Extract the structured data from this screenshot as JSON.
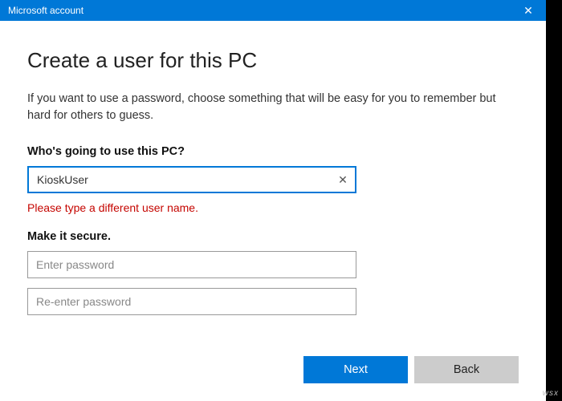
{
  "titlebar": {
    "title": "Microsoft account",
    "close_glyph": "✕"
  },
  "heading": "Create a user for this PC",
  "subtext": "If you want to use a password, choose something that will be easy for you to remember but hard for others to guess.",
  "section_who_label": "Who's going to use this PC?",
  "username_value": "KioskUser",
  "clear_glyph": "✕",
  "error_text": "Please type a different user name.",
  "section_secure_label": "Make it secure.",
  "password_placeholder": "Enter password",
  "password2_placeholder": "Re-enter password",
  "buttons": {
    "next": "Next",
    "back": "Back"
  },
  "watermark": "wsx"
}
